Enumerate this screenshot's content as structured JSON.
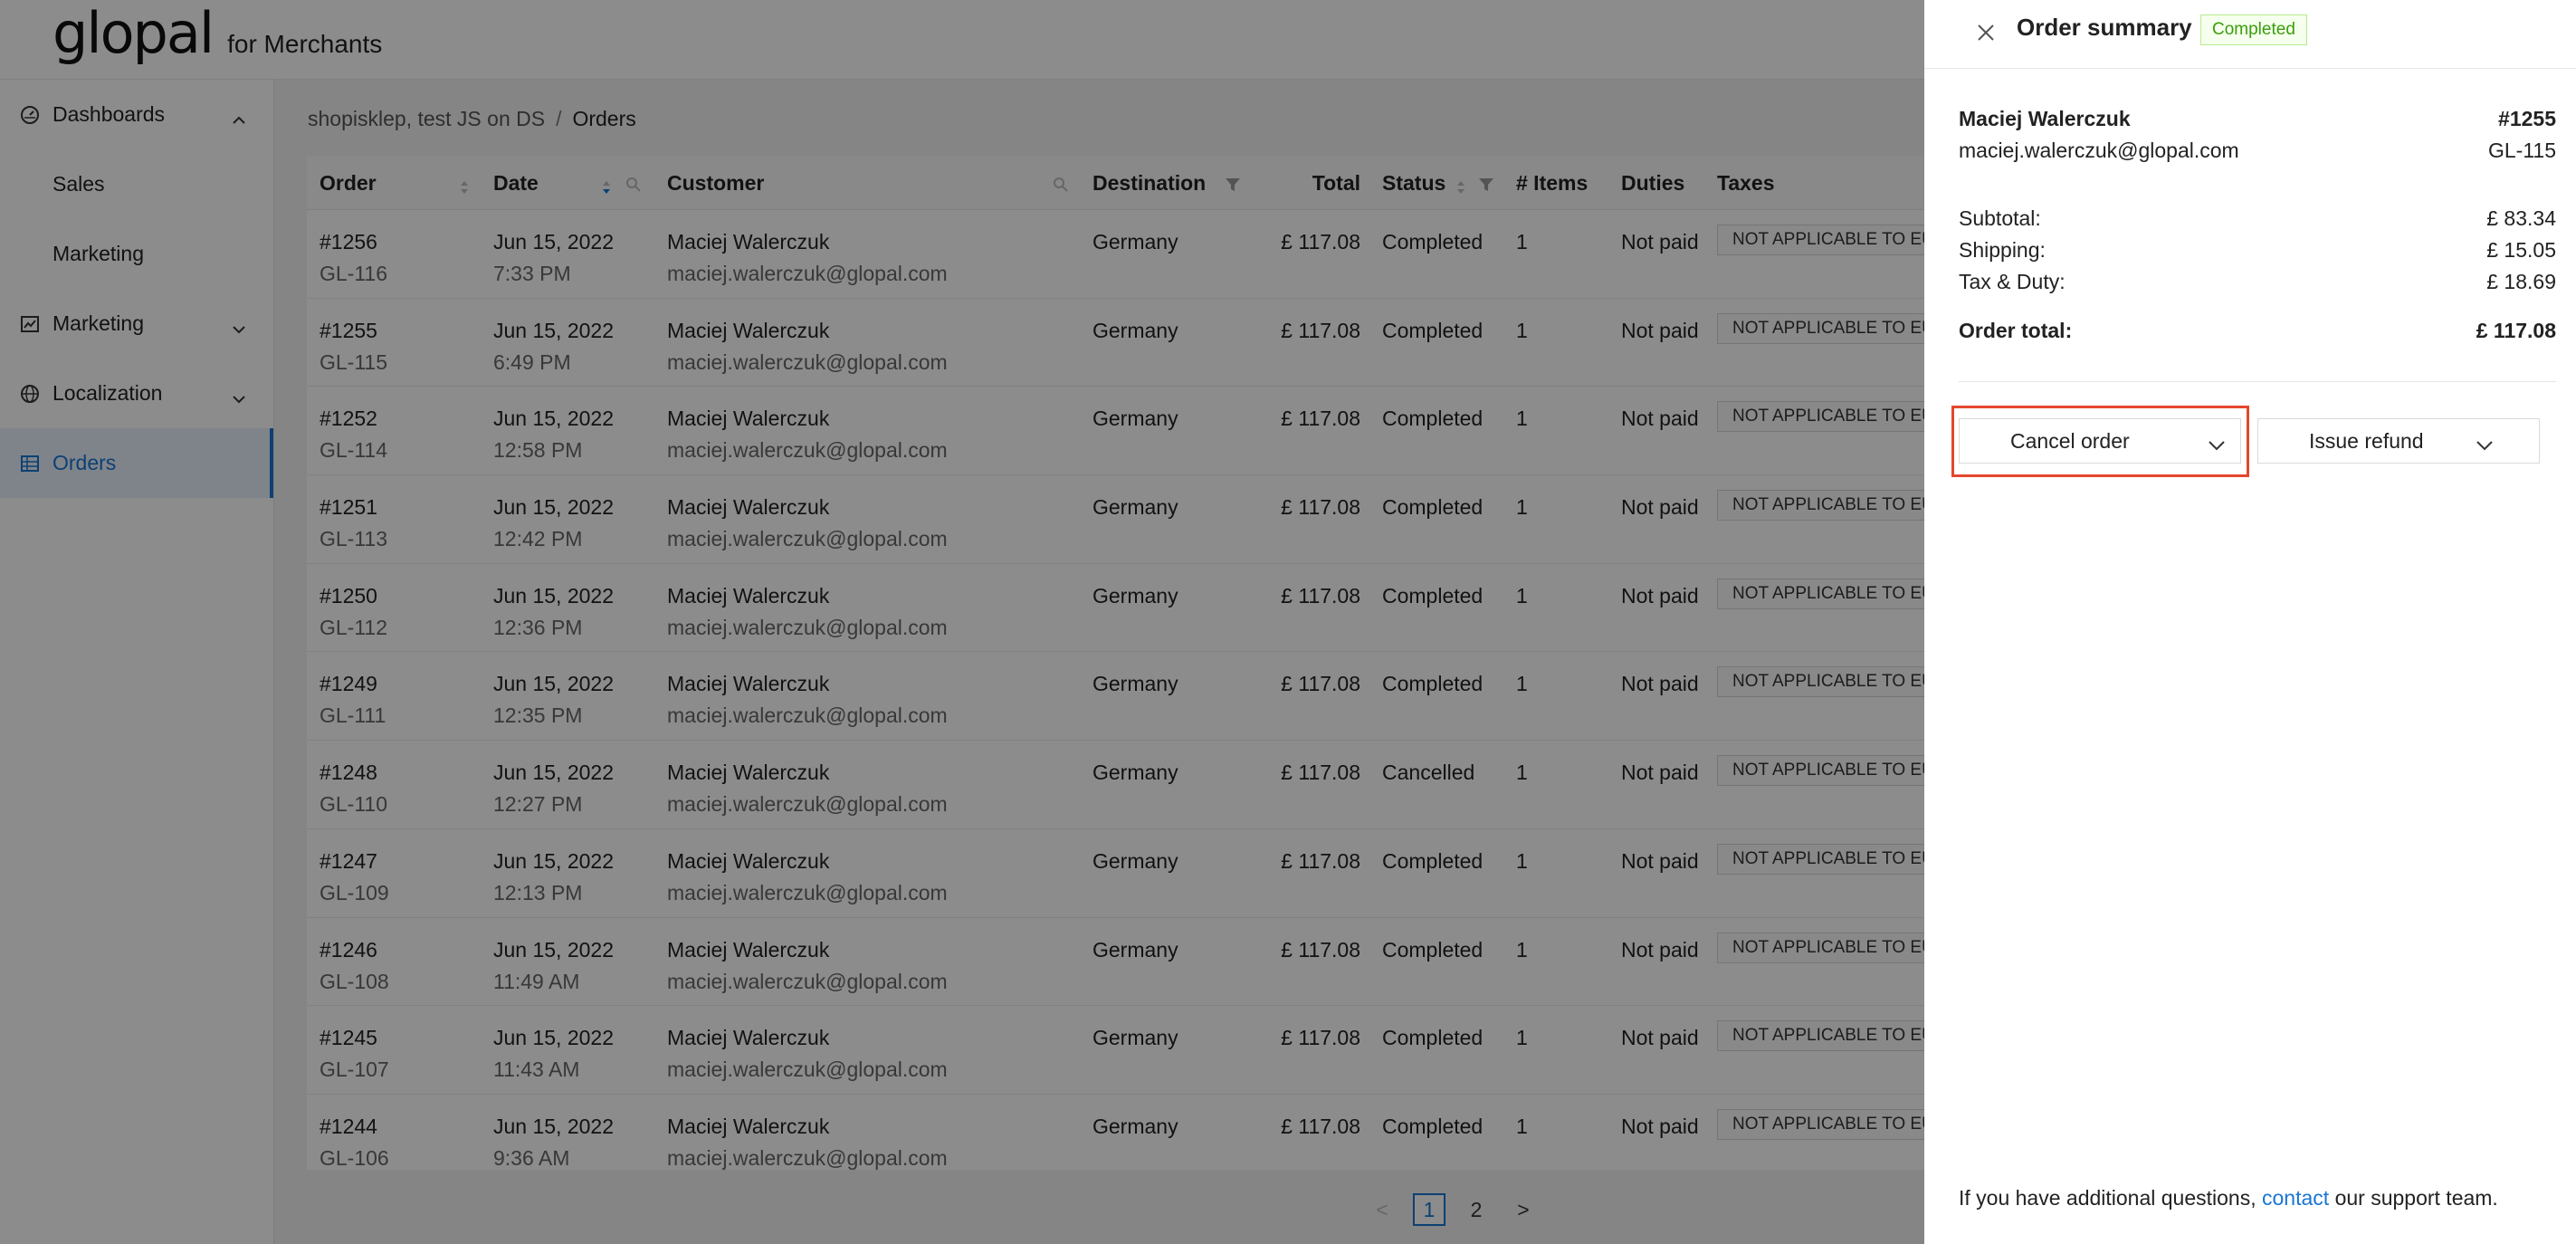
{
  "header": {
    "logo": "glopal",
    "logo_sub": "for Merchants"
  },
  "sidebar": {
    "items": [
      {
        "label": "Dashboards",
        "icon": "dashboard-icon"
      },
      {
        "label": "Sales"
      },
      {
        "label": "Marketing"
      },
      {
        "label": "Marketing",
        "icon": "chart-icon"
      },
      {
        "label": "Localization",
        "icon": "globe-icon"
      },
      {
        "label": "Orders",
        "icon": "table-icon"
      }
    ]
  },
  "breadcrumb": {
    "store": "shopisklep, test JS on DS",
    "separator": "/",
    "current": "Orders"
  },
  "table": {
    "columns": [
      "Order",
      "Date",
      "Customer",
      "Destination",
      "Total",
      "Status",
      "# Items",
      "Duties",
      "Taxes"
    ],
    "rows": [
      {
        "order": "#1256",
        "gl": "GL-116",
        "date": "Jun 15, 2022",
        "time": "7:33 PM",
        "customer": "Maciej Walerczuk",
        "email": "maciej.walerczuk@glopal.com",
        "destination": "Germany",
        "total": "£ 117.08",
        "status": "Completed",
        "items": "1",
        "duties": "Not paid",
        "taxes": "NOT APPLICABLE TO EU"
      },
      {
        "order": "#1255",
        "gl": "GL-115",
        "date": "Jun 15, 2022",
        "time": "6:49 PM",
        "customer": "Maciej Walerczuk",
        "email": "maciej.walerczuk@glopal.com",
        "destination": "Germany",
        "total": "£ 117.08",
        "status": "Completed",
        "items": "1",
        "duties": "Not paid",
        "taxes": "NOT APPLICABLE TO EU"
      },
      {
        "order": "#1252",
        "gl": "GL-114",
        "date": "Jun 15, 2022",
        "time": "12:58 PM",
        "customer": "Maciej Walerczuk",
        "email": "maciej.walerczuk@glopal.com",
        "destination": "Germany",
        "total": "£ 117.08",
        "status": "Completed",
        "items": "1",
        "duties": "Not paid",
        "taxes": "NOT APPLICABLE TO EU"
      },
      {
        "order": "#1251",
        "gl": "GL-113",
        "date": "Jun 15, 2022",
        "time": "12:42 PM",
        "customer": "Maciej Walerczuk",
        "email": "maciej.walerczuk@glopal.com",
        "destination": "Germany",
        "total": "£ 117.08",
        "status": "Completed",
        "items": "1",
        "duties": "Not paid",
        "taxes": "NOT APPLICABLE TO EU"
      },
      {
        "order": "#1250",
        "gl": "GL-112",
        "date": "Jun 15, 2022",
        "time": "12:36 PM",
        "customer": "Maciej Walerczuk",
        "email": "maciej.walerczuk@glopal.com",
        "destination": "Germany",
        "total": "£ 117.08",
        "status": "Completed",
        "items": "1",
        "duties": "Not paid",
        "taxes": "NOT APPLICABLE TO EU"
      },
      {
        "order": "#1249",
        "gl": "GL-111",
        "date": "Jun 15, 2022",
        "time": "12:35 PM",
        "customer": "Maciej Walerczuk",
        "email": "maciej.walerczuk@glopal.com",
        "destination": "Germany",
        "total": "£ 117.08",
        "status": "Completed",
        "items": "1",
        "duties": "Not paid",
        "taxes": "NOT APPLICABLE TO EU"
      },
      {
        "order": "#1248",
        "gl": "GL-110",
        "date": "Jun 15, 2022",
        "time": "12:27 PM",
        "customer": "Maciej Walerczuk",
        "email": "maciej.walerczuk@glopal.com",
        "destination": "Germany",
        "total": "£ 117.08",
        "status": "Cancelled",
        "items": "1",
        "duties": "Not paid",
        "taxes": "NOT APPLICABLE TO EU"
      },
      {
        "order": "#1247",
        "gl": "GL-109",
        "date": "Jun 15, 2022",
        "time": "12:13 PM",
        "customer": "Maciej Walerczuk",
        "email": "maciej.walerczuk@glopal.com",
        "destination": "Germany",
        "total": "£ 117.08",
        "status": "Completed",
        "items": "1",
        "duties": "Not paid",
        "taxes": "NOT APPLICABLE TO EU"
      },
      {
        "order": "#1246",
        "gl": "GL-108",
        "date": "Jun 15, 2022",
        "time": "11:49 AM",
        "customer": "Maciej Walerczuk",
        "email": "maciej.walerczuk@glopal.com",
        "destination": "Germany",
        "total": "£ 117.08",
        "status": "Completed",
        "items": "1",
        "duties": "Not paid",
        "taxes": "NOT APPLICABLE TO EU"
      },
      {
        "order": "#1245",
        "gl": "GL-107",
        "date": "Jun 15, 2022",
        "time": "11:43 AM",
        "customer": "Maciej Walerczuk",
        "email": "maciej.walerczuk@glopal.com",
        "destination": "Germany",
        "total": "£ 117.08",
        "status": "Completed",
        "items": "1",
        "duties": "Not paid",
        "taxes": "NOT APPLICABLE TO EU"
      },
      {
        "order": "#1244",
        "gl": "GL-106",
        "date": "Jun 15, 2022",
        "time": "9:36 AM",
        "customer": "Maciej Walerczuk",
        "email": "maciej.walerczuk@glopal.com",
        "destination": "Germany",
        "total": "£ 117.08",
        "status": "Completed",
        "items": "1",
        "duties": "Not paid",
        "taxes": "NOT APPLICABLE TO EU"
      }
    ]
  },
  "pagination": {
    "prev": "<",
    "pages": [
      "1",
      "2"
    ],
    "current": "1",
    "next": ">"
  },
  "drawer": {
    "title": "Order summary",
    "status": "Completed",
    "customer_name": "Maciej Walerczuk",
    "customer_email": "maciej.walerczuk@glopal.com",
    "order_number": "#1255",
    "gl_number": "GL-115",
    "subtotal_label": "Subtotal:",
    "subtotal_value": "£ 83.34",
    "shipping_label": "Shipping:",
    "shipping_value": "£ 15.05",
    "tax_label": "Tax & Duty:",
    "tax_value": "£ 18.69",
    "total_label": "Order total:",
    "total_value": "£ 117.08",
    "cancel_label": "Cancel order",
    "refund_label": "Issue refund",
    "footer_pre": "If you have additional questions,",
    "footer_link": "contact",
    "footer_post": "our support team."
  },
  "colors": {
    "accent": "#1976d2",
    "highlight": "#e5472d",
    "success": "#389e0d"
  }
}
